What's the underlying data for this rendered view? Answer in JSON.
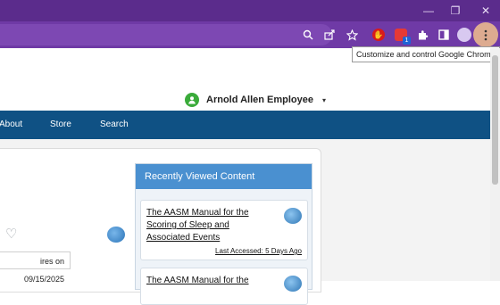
{
  "browser": {
    "window_controls": {
      "minimize": "—",
      "restore": "❐",
      "close": "✕"
    },
    "toolbar_icons": [
      "search-icon",
      "share-icon",
      "star-icon",
      "extension-red-icon",
      "extension-badge-icon",
      "puzzle-icon",
      "sidepanel-icon",
      "profile-avatar",
      "more-menu-icon"
    ],
    "extension_badge_text": "1",
    "tooltip": "Customize and control Google Chrome"
  },
  "header": {
    "user_name": "Arnold Allen Employee",
    "user_caret": "▾"
  },
  "nav": {
    "items": [
      "About",
      "Store",
      "Search"
    ]
  },
  "main": {
    "expires_text": "ires on 09/15/2025"
  },
  "recently_viewed": {
    "title": "Recently Viewed Content",
    "items": [
      {
        "title": "The AASM Manual for the Scoring of Sleep and Associated Events",
        "accessed": "Last Accessed: 5 Days Ago"
      },
      {
        "title": "The AASM Manual for the",
        "accessed": ""
      }
    ]
  },
  "colors": {
    "titlebar": "#5b2c8c",
    "toolbar": "#6f3aa6",
    "navbar": "#0f5184",
    "panel_header": "#4a90d0"
  }
}
